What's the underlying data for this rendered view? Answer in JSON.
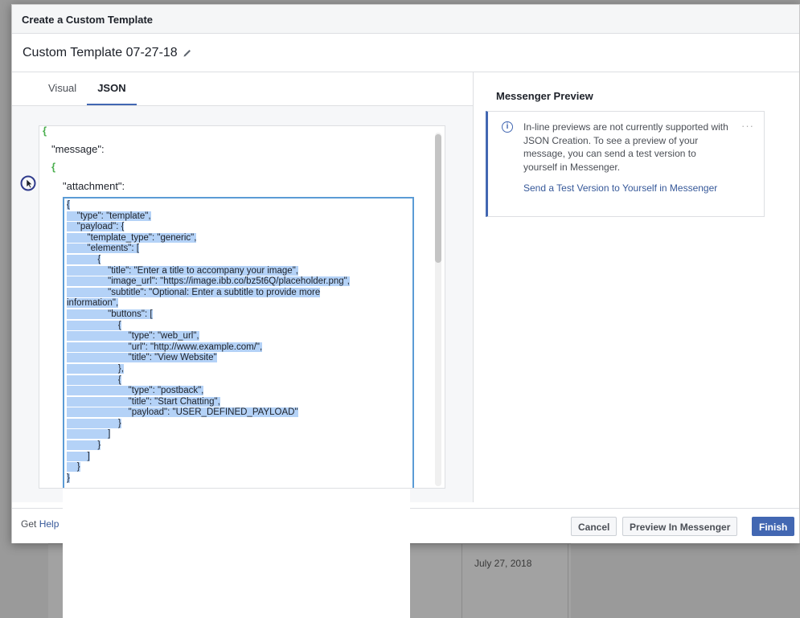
{
  "background": {
    "date": "July 27, 2018"
  },
  "modal": {
    "title": "Create a Custom Template",
    "template_name": "Custom Template 07-27-18",
    "tabs": [
      {
        "label": "Visual",
        "active": false
      },
      {
        "label": "JSON",
        "active": true
      }
    ],
    "editor": {
      "open_brace": "{",
      "message_key": "\"message\":",
      "open_brace_2": "{",
      "attachment_key": "\"attachment\":",
      "code_lines": [
        "{",
        "    \"type\": \"template\",",
        "    \"payload\": {",
        "        \"template_type\": \"generic\",",
        "        \"elements\": [",
        "            {",
        "                \"title\": \"Enter a title to accompany your image\",",
        "                \"image_url\": \"https://image.ibb.co/bz5t6Q/placeholder.png\",",
        "                \"subtitle\": \"Optional: Enter a subtitle to provide more",
        "information\",",
        "                \"buttons\": [",
        "                    {",
        "                        \"type\": \"web_url\",",
        "                        \"url\": \"http://www.example.com/\",",
        "                        \"title\": \"View Website\"",
        "                    },",
        "                    {",
        "                        \"type\": \"postback\",",
        "                        \"title\": \"Start Chatting\",",
        "                        \"payload\": \"USER_DEFINED_PAYLOAD\"",
        "                    }",
        "                ]",
        "            }",
        "        ]",
        "    }",
        "}"
      ]
    },
    "preview": {
      "title": "Messenger Preview",
      "notice": "In-line previews are not currently supported with JSON Creation. To see a preview of your message, you can send a test version to yourself in Messenger.",
      "link": "Send a Test Version to Yourself in Messenger",
      "more": "···"
    },
    "footer": {
      "help_prefix": "Get ",
      "help_link": "Help",
      "cancel": "Cancel",
      "preview": "Preview In Messenger",
      "finish": "Finish"
    }
  },
  "colors": {
    "accent": "#4267b2",
    "selection": "#b4d2f7",
    "json_brace": "#4caf50"
  }
}
